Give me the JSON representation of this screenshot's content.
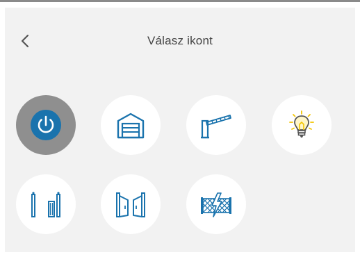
{
  "header": {
    "title": "Válasz ikont",
    "back_icon": "chevron-left-icon"
  },
  "icons": [
    {
      "name": "power-icon",
      "selected": true
    },
    {
      "name": "garage-icon",
      "selected": false
    },
    {
      "name": "barrier-gate-icon",
      "selected": false
    },
    {
      "name": "light-bulb-icon",
      "selected": false
    },
    {
      "name": "sliding-gate-icon",
      "selected": false
    },
    {
      "name": "swing-gate-icon",
      "selected": false
    },
    {
      "name": "electric-fence-icon",
      "selected": false
    }
  ],
  "colors": {
    "accent_blue": "#1a73ad",
    "selected_tile": "#8f8f8f",
    "panel_background": "#f2f2f2",
    "bulb_yellow": "#f2c400",
    "text": "#444444"
  }
}
